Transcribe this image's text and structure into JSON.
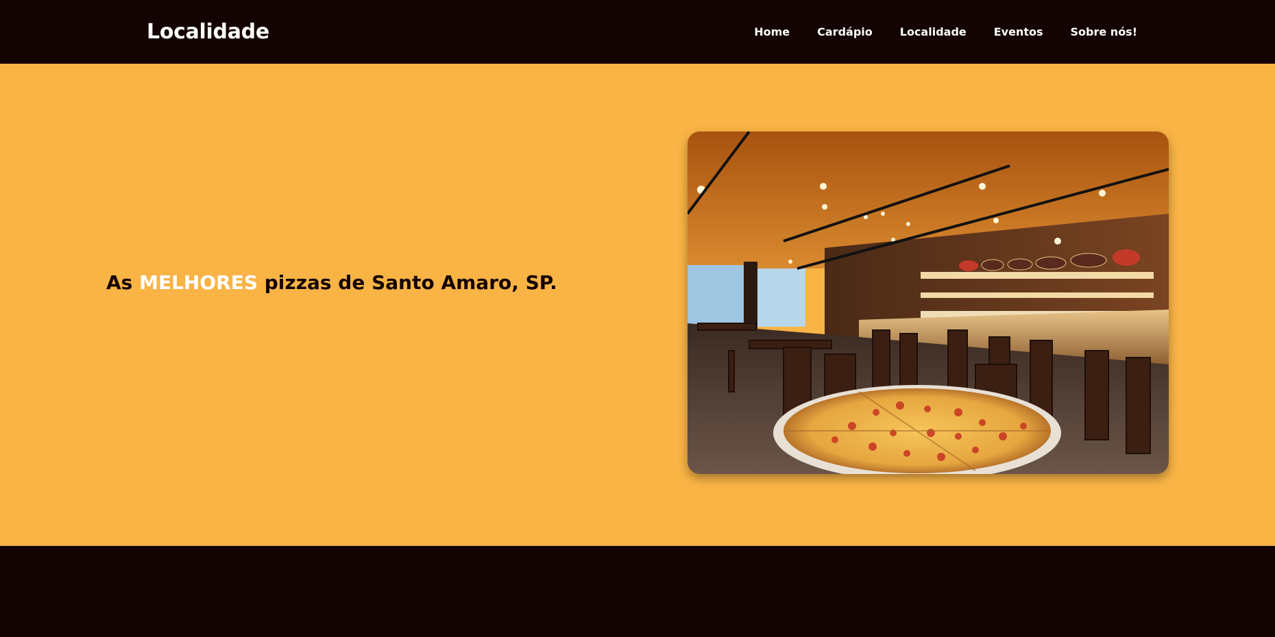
{
  "header": {
    "brand": "Localidade",
    "nav": [
      {
        "label": "Home"
      },
      {
        "label": "Cardápio"
      },
      {
        "label": "Localidade"
      },
      {
        "label": "Eventos"
      },
      {
        "label": "Sobre nós!"
      }
    ]
  },
  "hero": {
    "headline_prefix": "As",
    "headline_highlight": "MELHORES",
    "headline_suffix": "pizzas de Santo Amaro, SP."
  },
  "colors": {
    "header_bg": "#140303",
    "hero_bg": "#f9b445",
    "highlight_text": "#ffffff",
    "body_text": "#140303"
  }
}
